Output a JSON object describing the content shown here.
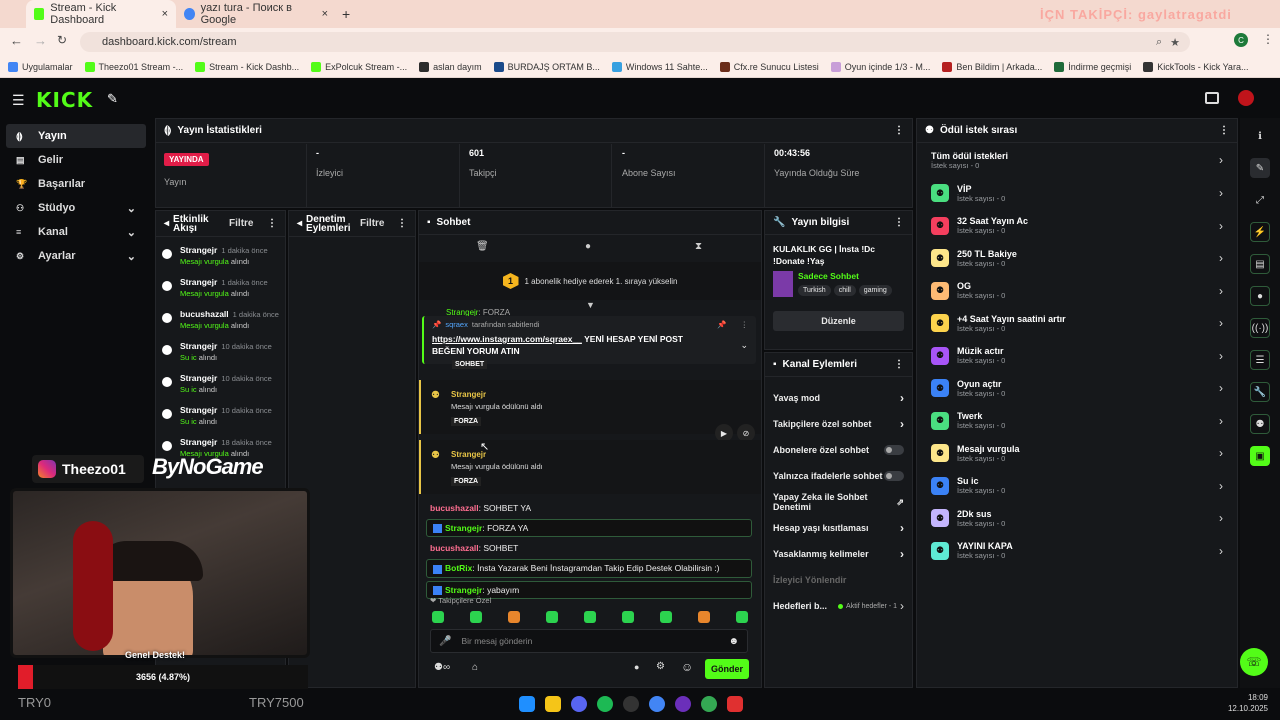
{
  "browser": {
    "tabs": [
      {
        "label": "Stream - Kick Dashboard",
        "active": true
      },
      {
        "label": "yazı tura - Поиск в Google",
        "active": false
      }
    ],
    "url": "dashboard.kick.com/stream",
    "overlay_text": "İÇN TAKİPÇİ: gaylatragatdi",
    "profile_initial": "C",
    "bookmarks": [
      "Uygulamalar",
      "Theezo01 Stream -...",
      "Stream - Kick Dashb...",
      "ExPolcuk Stream -...",
      "aslan dayım",
      "BURDAJŞ ORTAM B...",
      "Windows 11 Sahte...",
      "Cfx.re Sunucu Listesi",
      "Oyun içinde 1/3 - M...",
      "Ben Bildim | Arkada...",
      "İndirme geçmişi",
      "KickTools - Kick Yara..."
    ]
  },
  "logo": "KICK",
  "sidebar": {
    "items": [
      {
        "label": "Yayın",
        "active": true
      },
      {
        "label": "Gelir"
      },
      {
        "label": "Başarılar"
      },
      {
        "label": "Stüdyo",
        "expand": true
      },
      {
        "label": "Kanal",
        "expand": true
      },
      {
        "label": "Ayarlar",
        "expand": true
      }
    ]
  },
  "stats": {
    "title": "Yayın İstatistikleri",
    "live_badge": "YAYINDA",
    "live_label": "Yayın",
    "viewers_value": "-",
    "viewers_label": "İzleyici",
    "followers_value": "601",
    "followers_label": "Takipçi",
    "subs_value": "-",
    "subs_label": "Abone Sayısı",
    "duration_value": "00:43:56",
    "duration_label": "Yayında Olduğu Süre"
  },
  "activity": {
    "title": "Etkinlik Akışı",
    "filter": "Filtre",
    "rows": [
      {
        "user": "Strangejr",
        "time": "1 dakika önce",
        "action": "Mesajı vurgula",
        "suffix": "alındı"
      },
      {
        "user": "Strangejr",
        "time": "1 dakika önce",
        "action": "Mesajı vurgula",
        "suffix": "alındı"
      },
      {
        "user": "bucushazall",
        "time": "1 dakika önce",
        "action": "Mesajı vurgula",
        "suffix": "alındı"
      },
      {
        "user": "Strangejr",
        "time": "10 dakika önce",
        "action": "Su ic",
        "suffix": "alındı"
      },
      {
        "user": "Strangejr",
        "time": "10 dakika önce",
        "action": "Su ic",
        "suffix": "alındı"
      },
      {
        "user": "Strangejr",
        "time": "10 dakika önce",
        "action": "Su ic",
        "suffix": "alındı"
      },
      {
        "user": "Strangejr",
        "time": "18 dakika önce",
        "action": "Mesajı vurgula",
        "suffix": "alındı"
      }
    ]
  },
  "moderation": {
    "title": "Denetim Eylemleri",
    "filter": "Filtre"
  },
  "chat": {
    "title": "Sohbet",
    "sub_banner": "1 abonelik hediye ederek 1. sıraya yükselin",
    "sub_badge": "1",
    "pinned_by": "sqraex",
    "pinned_suffix": "tarafından sabitlendi",
    "pinned_link": "https://www.instagram.com/sqraex__",
    "pinned_text": " YENİ HESAP YENİ POST BEĞENİ YORUM ATIN",
    "partial_user": "Strangejr",
    "partial_text": "FORZA",
    "partial_tag": "SOHBET",
    "redeems": [
      {
        "user": "Strangejr",
        "text": "Mesajı vurgula ödülünü aldı",
        "tag": "FORZA"
      },
      {
        "user": "Strangejr",
        "text": "Mesajı vurgula ödülünü aldı",
        "tag": "FORZA"
      }
    ],
    "messages": [
      {
        "user": "bucushazall",
        "text": "SOHBET YA",
        "highlight": false,
        "color": "#ff6f91"
      },
      {
        "user": "Strangejr",
        "text": "FORZA YA",
        "highlight": true,
        "color": "#53fc18"
      },
      {
        "user": "bucushazall",
        "text": "SOHBET",
        "highlight": false,
        "color": "#ff6f91"
      },
      {
        "user": "BotRix",
        "text": "İnsta Yazarak Beni İnstagramdan Takip Edip Destek Olabilirsin :)",
        "highlight": true,
        "color": "#53fc18"
      },
      {
        "user": "Strangejr",
        "text": "yabayım",
        "highlight": true,
        "color": "#53fc18"
      }
    ],
    "emote_label": "Takipçilere Özel",
    "input_placeholder": "Bir mesaj gönderin",
    "send_label": "Gönder"
  },
  "stream_info": {
    "title": "Yayın bilgisi",
    "stream_title": "KULAKLIK GG | İnsta !Dc !Donate !Yaş",
    "category": "Sadece Sohbet",
    "tags": [
      "Turkish",
      "chill",
      "gaming"
    ],
    "edit_label": "Düzenle"
  },
  "channel_actions": {
    "title": "Kanal Eylemleri",
    "rows": [
      {
        "label": "Yavaş mod",
        "kind": "chev"
      },
      {
        "label": "Takipçilere özel sohbet",
        "kind": "chev"
      },
      {
        "label": "Abonelere özel sohbet",
        "kind": "toggle"
      },
      {
        "label": "Yalnızca ifadelerle sohbet",
        "kind": "toggle"
      },
      {
        "label": "Yapay Zeka ile Sohbet Denetimi",
        "kind": "ext"
      },
      {
        "label": "Hesap yaşı kısıtlaması",
        "kind": "chev"
      },
      {
        "label": "Yasaklanmış kelimeler",
        "kind": "chev"
      },
      {
        "label": "İzleyici Yönlendir",
        "kind": "none"
      },
      {
        "label": "Hedefleri b...",
        "kind": "goal",
        "extra": "Aktif hedefler - 1"
      }
    ]
  },
  "rewards": {
    "title": "Ödül istek sırası",
    "all_label": "Tüm ödül istekleri",
    "all_sub": "İstek sayısı - 0",
    "items": [
      {
        "name": "VİP",
        "sub": "İstek sayısı - 0",
        "color": "#4ade80"
      },
      {
        "name": "32 Saat Yayın Ac",
        "sub": "İstek sayısı - 0",
        "color": "#f43f5e"
      },
      {
        "name": "250 TL Bakiye",
        "sub": "İstek sayısı - 0",
        "color": "#fde68a"
      },
      {
        "name": "OG",
        "sub": "İstek sayısı - 0",
        "color": "#fdba74"
      },
      {
        "name": "+4 Saat Yayın saatini artır",
        "sub": "İstek sayısı - 0",
        "color": "#fcd34d"
      },
      {
        "name": "Müzik actır",
        "sub": "İstek sayısı - 0",
        "color": "#a855f7"
      },
      {
        "name": "Oyun açtır",
        "sub": "İstek sayısı - 0",
        "color": "#3b82f6"
      },
      {
        "name": "Twerk",
        "sub": "İstek sayısı - 0",
        "color": "#4ade80"
      },
      {
        "name": "Mesajı vurgula",
        "sub": "İstek sayısı - 0",
        "color": "#fde68a"
      },
      {
        "name": "Su ic",
        "sub": "İstek sayısı - 0",
        "color": "#3b82f6"
      },
      {
        "name": "2Dk sus",
        "sub": "İstek sayısı - 0",
        "color": "#c4b5fd"
      },
      {
        "name": "YAYINI KAPA",
        "sub": "İstek sayısı - 0",
        "color": "#5eead4"
      }
    ]
  },
  "overlay": {
    "instagram": "Theezo01",
    "brand": "ByNoGame",
    "support_label": "Genel Destek!",
    "progress_text": "3656 (4.87%)",
    "progress_pct": 4.87,
    "min_label": "TRY0",
    "max_label": "TRY7500"
  },
  "taskbar": {
    "time": "18:09",
    "date": "12.10.2025"
  }
}
